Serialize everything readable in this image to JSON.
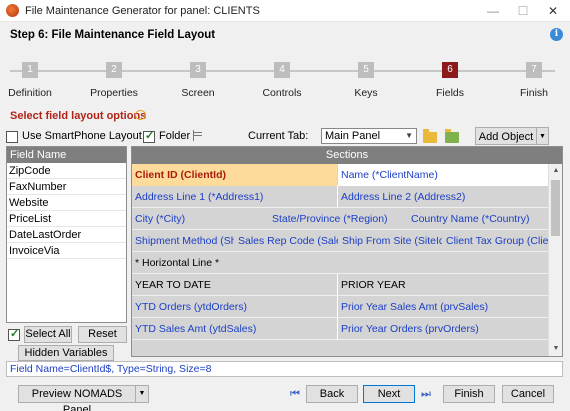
{
  "window": {
    "title": "File Maintenance Generator for panel: CLIENTS",
    "minimize_glyph": "—",
    "maximize_glyph": "☐",
    "close_glyph": "✕"
  },
  "header": {
    "step_title": "Step 6: File Maintenance Field Layout",
    "info_glyph": "i"
  },
  "steps": [
    {
      "num": "1",
      "label": "Definition"
    },
    {
      "num": "2",
      "label": "Properties"
    },
    {
      "num": "3",
      "label": "Screen"
    },
    {
      "num": "4",
      "label": "Controls"
    },
    {
      "num": "5",
      "label": "Keys"
    },
    {
      "num": "6",
      "label": "Fields",
      "active": true
    },
    {
      "num": "7",
      "label": "Finish"
    }
  ],
  "section": {
    "title": "Select field layout options"
  },
  "toolbar": {
    "smartphone_label": "Use SmartPhone Layout",
    "smartphone_checked": false,
    "folder_label": "Folder",
    "folder_checked": true,
    "current_tab_label": "Current Tab:",
    "current_tab_value": "Main Panel",
    "add_object_label": "Add Object"
  },
  "field_list": {
    "header": "Field Name",
    "items": [
      "ZipCode",
      "FaxNumber",
      "Website",
      "PriceList",
      "DateLastOrder",
      "InvoiceVia"
    ]
  },
  "left_buttons": {
    "select_all": "Select All",
    "reset": "Reset",
    "hidden_variables": "Hidden Variables",
    "select_all_checked": true
  },
  "grid": {
    "header": "Sections",
    "rows": [
      [
        "Client ID (ClientId)",
        "Name (*ClientName)"
      ],
      [
        "Address Line 1 (*Address1)",
        "Address Line 2 (Address2)"
      ],
      [
        "City (*City)",
        "State/Province (*Region)",
        "Country Name (*Country)"
      ],
      [
        "Shipment Method (Ship'...",
        "Sales Rep Code (Sales...",
        "Ship From Site (SiteId)",
        "Client Tax Group (Client'..."
      ],
      [
        "* Horizontal Line *"
      ],
      [
        "YEAR TO DATE",
        "PRIOR YEAR"
      ],
      [
        "YTD Orders (ytdOrders)",
        "Prior Year Sales Amt (prvSales)"
      ],
      [
        "YTD Sales Amt (ytdSales)",
        "Prior Year Orders (prvOrders)"
      ]
    ]
  },
  "status": {
    "text": "Field Name=ClientId$,  Type=String,  Size=8"
  },
  "footer": {
    "preview_label": "Preview NOMADS Panel",
    "back_label": "Back",
    "next_label": "Next",
    "finish_label": "Finish",
    "cancel_label": "Cancel"
  }
}
